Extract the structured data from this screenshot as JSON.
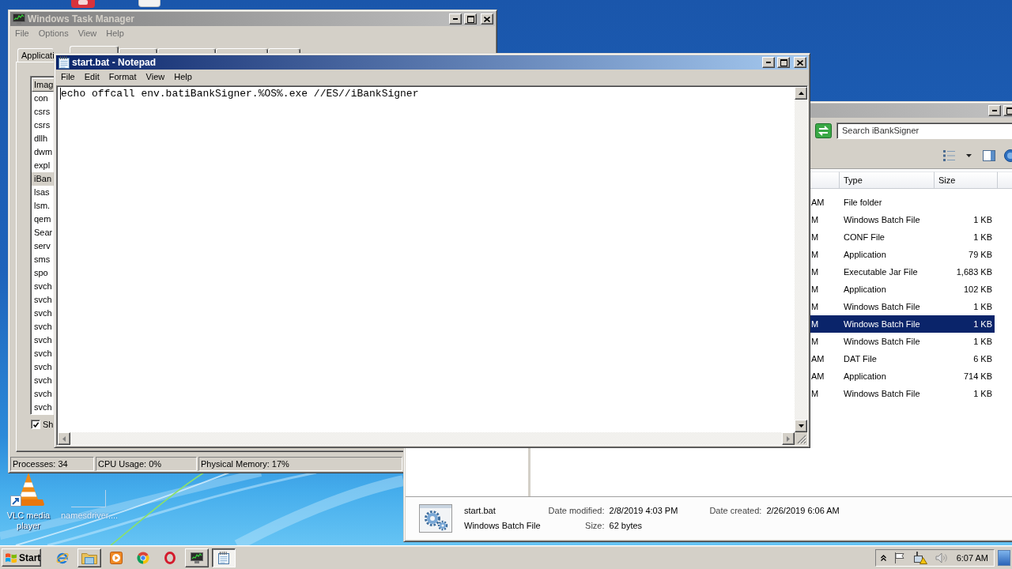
{
  "desktop": {
    "icons": [
      {
        "kind": "vlc",
        "label": "VLC media player"
      },
      {
        "kind": "blank",
        "label": "namesdriver...."
      }
    ]
  },
  "task_manager": {
    "title": "Windows Task Manager",
    "active": false,
    "menu": [
      "File",
      "Options",
      "View",
      "Help"
    ],
    "tabs": [
      {
        "label": "Applicati",
        "selected": false
      },
      {
        "selected": true
      },
      {
        "selected": false
      },
      {
        "selected": false
      },
      {
        "selected": false
      },
      {
        "selected": false
      }
    ],
    "process_list": {
      "column": "Imag",
      "rows": [
        {
          "name": "con",
          "selected": false
        },
        {
          "name": "csrs",
          "selected": false
        },
        {
          "name": "csrs",
          "selected": false
        },
        {
          "name": "dllh",
          "selected": false
        },
        {
          "name": "dwm",
          "selected": false
        },
        {
          "name": "expl",
          "selected": false
        },
        {
          "name": "iBan",
          "selected": true
        },
        {
          "name": "lsas",
          "selected": false
        },
        {
          "name": "lsm.",
          "selected": false
        },
        {
          "name": "qem",
          "selected": false
        },
        {
          "name": "Sear",
          "selected": false
        },
        {
          "name": "serv",
          "selected": false
        },
        {
          "name": "sms",
          "selected": false
        },
        {
          "name": "spo",
          "selected": false
        },
        {
          "name": "svch",
          "selected": false
        },
        {
          "name": "svch",
          "selected": false
        },
        {
          "name": "svch",
          "selected": false
        },
        {
          "name": "svch",
          "selected": false
        },
        {
          "name": "svch",
          "selected": false
        },
        {
          "name": "svch",
          "selected": false
        },
        {
          "name": "svch",
          "selected": false
        },
        {
          "name": "svch",
          "selected": false
        },
        {
          "name": "svch",
          "selected": false
        },
        {
          "name": "svch",
          "selected": false
        }
      ]
    },
    "show_all": {
      "label": "Sh",
      "checked": true
    },
    "status_bar": [
      "Processes: 34",
      "CPU Usage: 0%",
      "Physical Memory: 17%"
    ]
  },
  "explorer": {
    "active": false,
    "search": {
      "placeholder": "Search iBankSigner"
    },
    "columns": [
      "Type",
      "Size"
    ],
    "rows": [
      {
        "column_1": "AM",
        "type": "File folder",
        "selected": false
      },
      {
        "column_1": "M",
        "type": "Windows Batch File",
        "size": "1 KB",
        "selected": false
      },
      {
        "column_1": "M",
        "type": "CONF File",
        "size": "1 KB",
        "selected": false
      },
      {
        "column_1": "M",
        "type": "Application",
        "size": "79 KB",
        "selected": false
      },
      {
        "column_1": "M",
        "type": "Executable Jar File",
        "size": "1,683 KB",
        "selected": false
      },
      {
        "column_1": "M",
        "type": "Application",
        "size": "102 KB",
        "selected": false
      },
      {
        "column_1": "M",
        "type": "Windows Batch File",
        "size": "1 KB",
        "selected": false
      },
      {
        "column_1": "M",
        "type": "Windows Batch File",
        "size": "1 KB",
        "selected": true
      },
      {
        "column_1": "M",
        "type": "Windows Batch File",
        "size": "1 KB",
        "selected": false
      },
      {
        "column_1": "AM",
        "type": "DAT File",
        "size": "6 KB",
        "selected": false
      },
      {
        "column_1": "AM",
        "type": "Application",
        "size": "714 KB",
        "selected": false
      },
      {
        "column_1": "M",
        "type": "Windows Batch File",
        "size": "1 KB",
        "selected": false
      }
    ],
    "details": {
      "name": "start.bat",
      "type": "Windows Batch File",
      "date_modified": {
        "label": "Date modified:",
        "value": "2/8/2019 4:03 PM"
      },
      "size": {
        "label": "Size:",
        "value": "62 bytes"
      },
      "date_created": {
        "label": "Date created:",
        "value": "2/26/2019 6:06 AM"
      }
    }
  },
  "notepad": {
    "title": "start.bat - Notepad",
    "active": true,
    "menu": [
      "File",
      "Edit",
      "Format",
      "View",
      "Help"
    ],
    "text": "echo offcall env.batiBankSigner.%OS%.exe //ES//iBankSigner"
  },
  "taskbar": {
    "start": "Start",
    "items": [
      {
        "kind": "ie",
        "running": false,
        "selected": false
      },
      {
        "kind": "folder",
        "running": true,
        "selected": false
      },
      {
        "kind": "media",
        "running": false,
        "selected": false
      },
      {
        "kind": "chrome",
        "running": false,
        "selected": false
      },
      {
        "kind": "opera",
        "running": false,
        "selected": false
      },
      {
        "kind": "taskmgr",
        "running": true,
        "selected": false
      },
      {
        "kind": "notepad",
        "running": true,
        "selected": true
      }
    ],
    "tray": [
      {
        "kind": "chevron"
      },
      {
        "kind": "flag"
      },
      {
        "kind": "network"
      },
      {
        "kind": "speaker"
      }
    ],
    "clock": "6:07 AM"
  }
}
